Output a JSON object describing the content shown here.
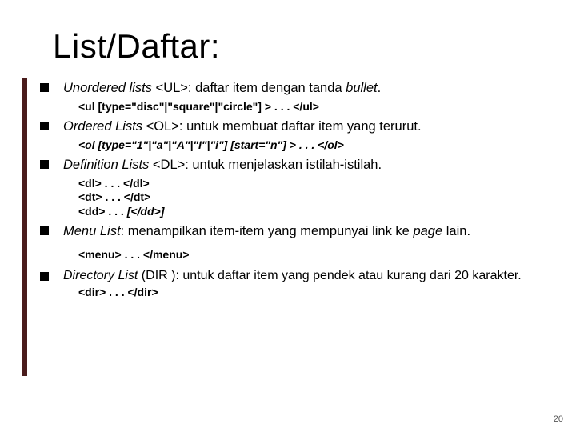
{
  "title": "List/Daftar:",
  "items": [
    {
      "label_pre_em": "Unordered lists",
      "label_post": " <UL>: daftar item dengan tanda ",
      "label_em2": "bullet",
      "label_tail": ".",
      "code": "<ul [type=\"disc\"|\"square\"|\"circle\"] > . . . </ul>"
    },
    {
      "label_pre_em": "Ordered Lists",
      "label_post": " <OL>: untuk membuat daftar item yang terurut.",
      "code_italic": "<ol [type=\"1\"|\"a\"|\"A\"|\"I\"|\"i\"] [start=\"n\"] > . . . </ol>"
    },
    {
      "label_pre_em": "Definition Lists",
      "label_post": " <DL>: untuk menjelaskan istilah-istilah.",
      "code_lines": [
        "<dl> . . . </dl>",
        "<dt> . . . </dt>"
      ],
      "code_line3_pre": "<dd> . . . ",
      "code_line3_em": "[</dd>]"
    },
    {
      "label_pre_em": "Menu List",
      "label_post": ": menampilkan item-item yang mempunyai link ke ",
      "label_em2": "page",
      "label_tail": " lain.",
      "code": "<menu> . . . </menu>"
    },
    {
      "label_pre_em": "Directory List",
      "label_post": " (DIR ): untuk daftar item yang pendek atau kurang dari 20 karakter.",
      "code": "<dir> . . . </dir>"
    }
  ],
  "page_number": "20"
}
